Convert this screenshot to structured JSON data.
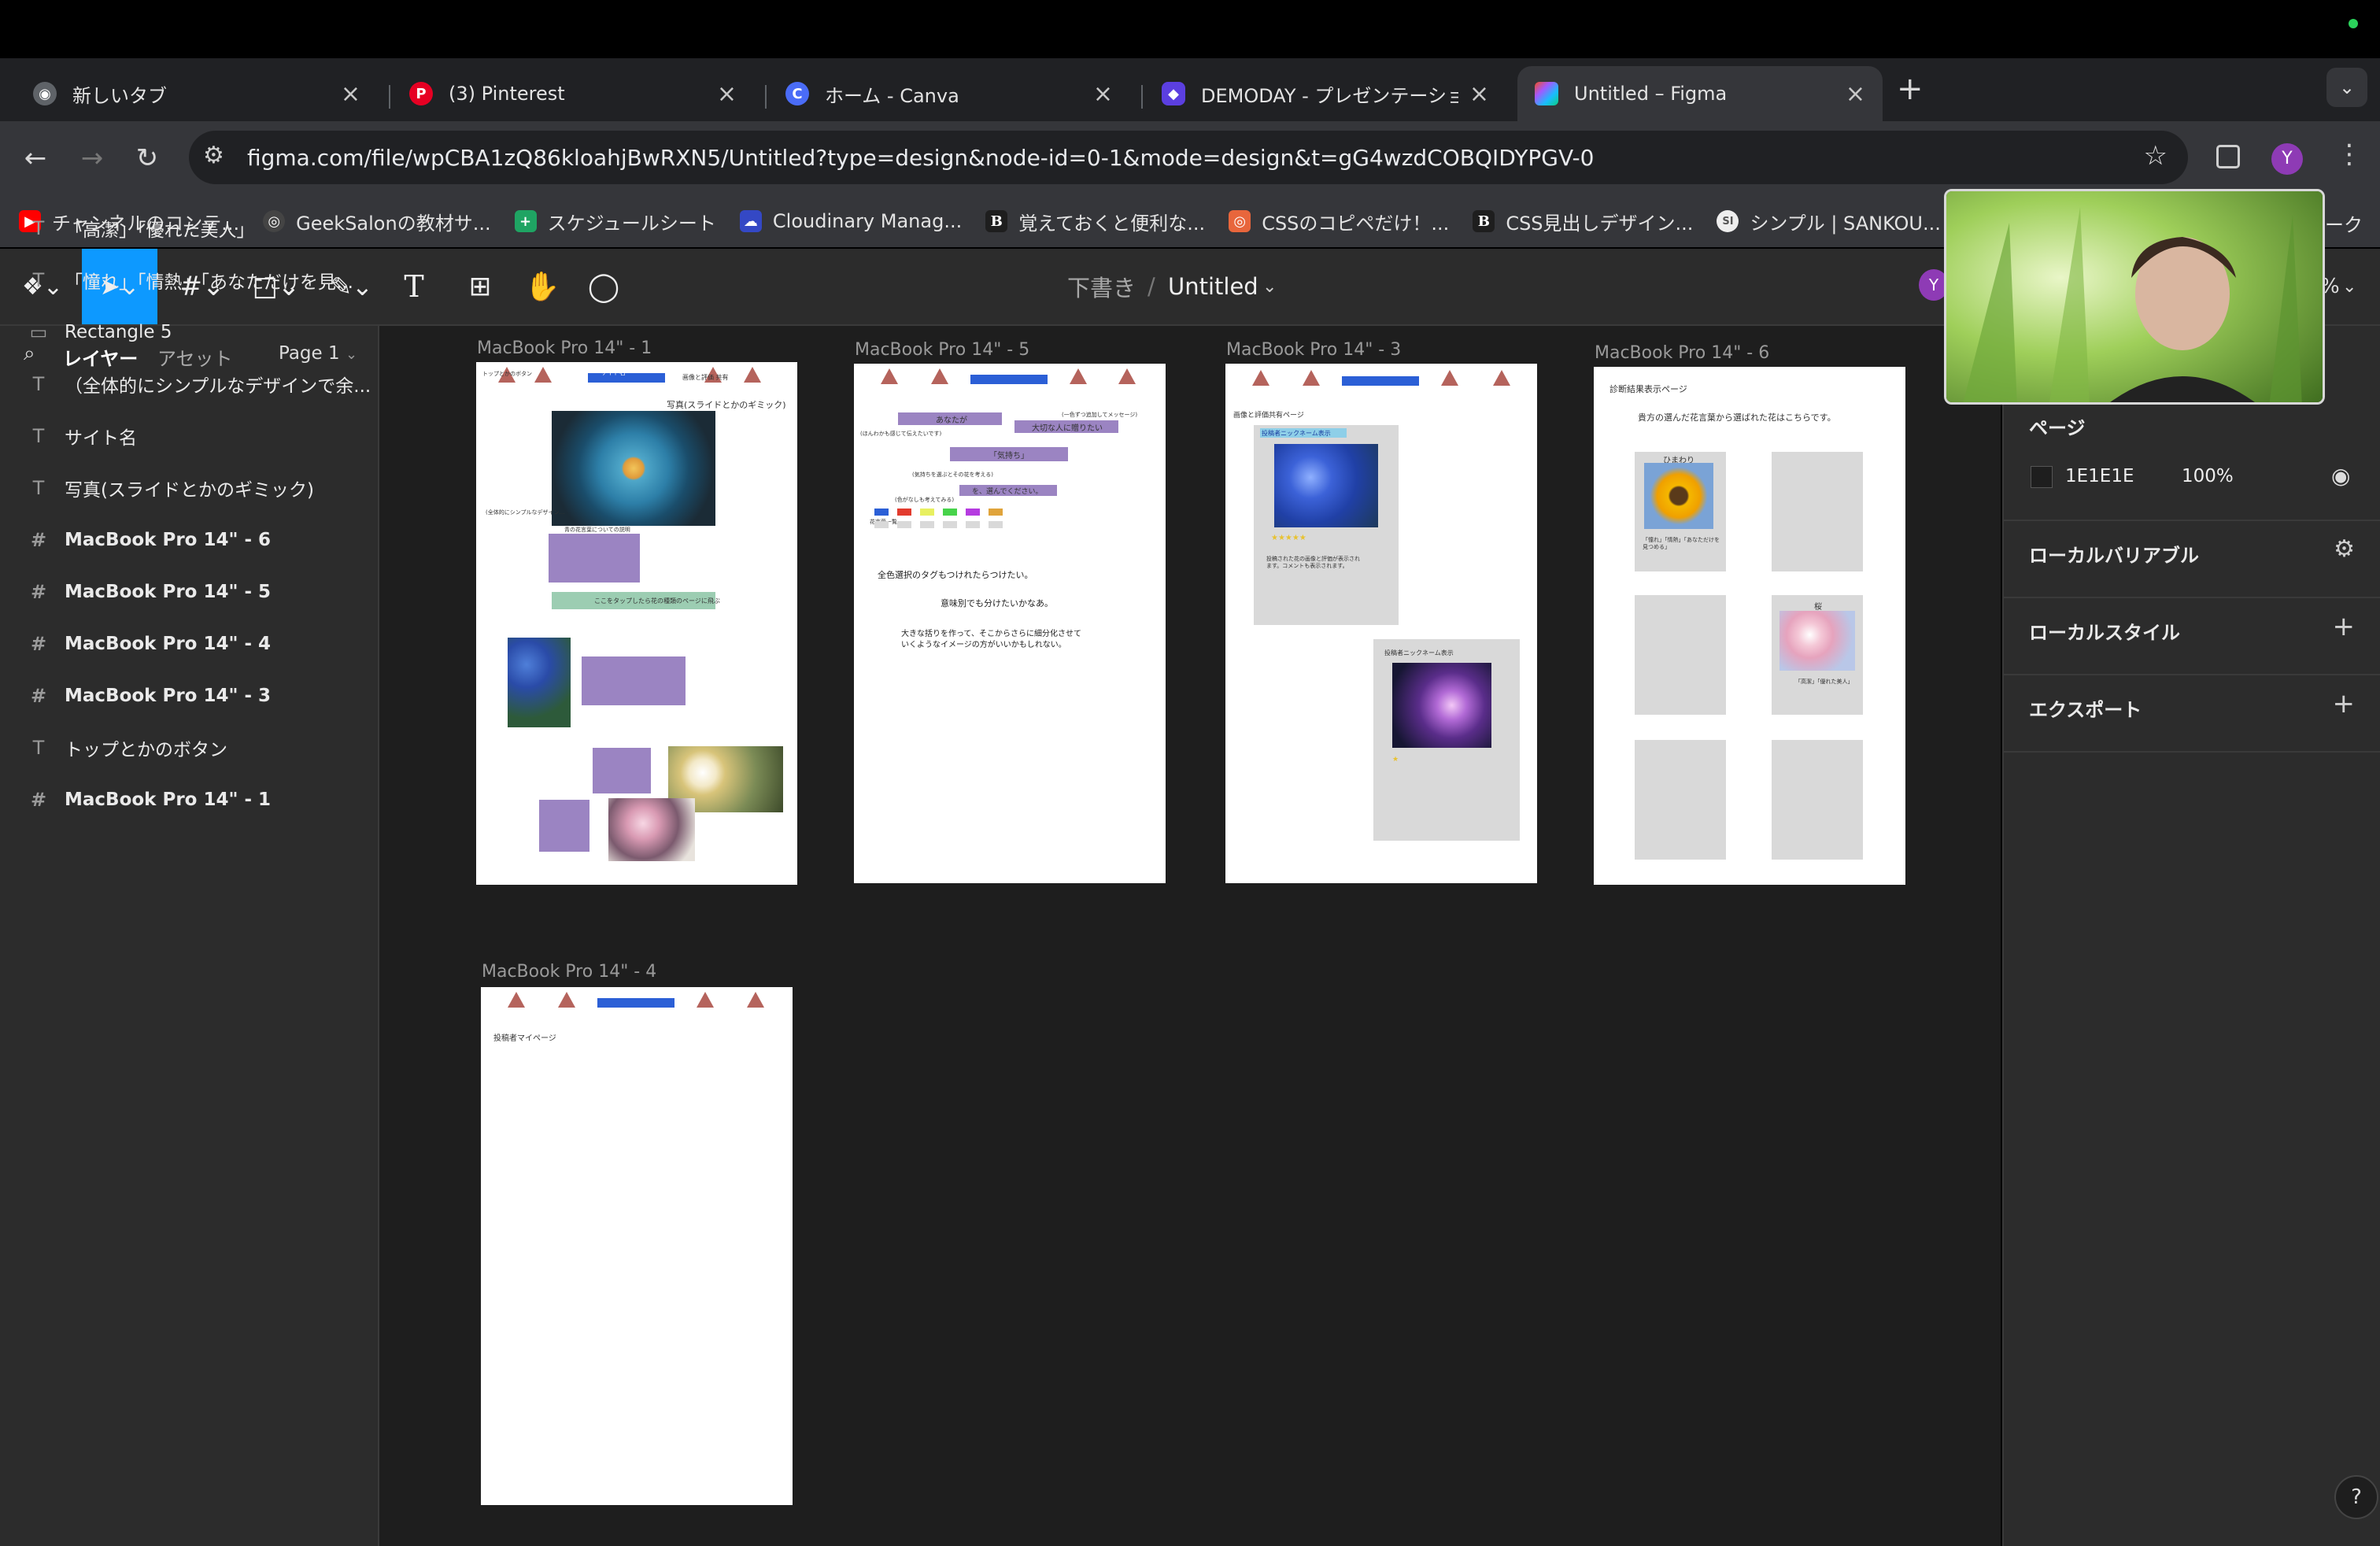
{
  "colors": {
    "accent": "#0d99ff",
    "purple_box": "#9b84c2",
    "blue_bar": "#2b5fd6",
    "triangle": "#b5635c",
    "gray_box": "#d9d9d9"
  },
  "browser": {
    "tabs": [
      {
        "title": "新しいタブ",
        "icon": "chrome-icon",
        "active": false
      },
      {
        "title": "(3) Pinterest",
        "icon": "pinterest-icon",
        "active": false
      },
      {
        "title": "ホーム - Canva",
        "icon": "canva-icon",
        "active": false
      },
      {
        "title": "DEMODAY - プレゼンテーショ",
        "icon": "demoday-icon",
        "active": false
      },
      {
        "title": "Untitled – Figma",
        "icon": "figma-icon",
        "active": true
      }
    ],
    "url": "figma.com/file/wpCBA1zQ86kloahjBwRXN5/Untitled?type=design&node-id=0-1&mode=design&t=gG4wzdCOBQIDYPGV-0",
    "profile_initial": "Y",
    "bookmarks": [
      {
        "label": "チャンネルのコンテ...",
        "icon": "youtube-icon"
      },
      {
        "label": "GeekSalonの教材サ...",
        "icon": "geeksalon-icon"
      },
      {
        "label": "スケジュールシート",
        "icon": "sheets-icon"
      },
      {
        "label": "Cloudinary Manag...",
        "icon": "cloudinary-icon"
      },
      {
        "label": "覚えておくと便利な...",
        "icon": "b-icon"
      },
      {
        "label": "CSSのコピペだけ！...",
        "icon": "css-icon"
      },
      {
        "label": "CSS見出しデザイン...",
        "icon": "b-icon"
      },
      {
        "label": "シンプル | SANKOU...",
        "icon": "sankou-icon"
      },
      {
        "label": "ーク",
        "icon": ""
      }
    ]
  },
  "figma": {
    "breadcrumb_folder": "下書き",
    "breadcrumb_sep": "/",
    "file_name": "Untitled",
    "user_initial": "Y",
    "zoom_suffix": "%",
    "left_panel": {
      "tab_layers": "レイヤー",
      "tab_assets": "アセット",
      "page_selector": "Page 1",
      "layers": [
        {
          "icon": "T",
          "label": "「高潔」「優れた美人」",
          "bold": false
        },
        {
          "icon": "T",
          "label": "「憧れ」「情熱」「あなただけを見...",
          "bold": false
        },
        {
          "icon": "▭",
          "label": "Rectangle 5",
          "bold": false
        },
        {
          "icon": "T",
          "label": "（全体的にシンプルなデザインで余...",
          "bold": false
        },
        {
          "icon": "T",
          "label": "サイト名",
          "bold": false
        },
        {
          "icon": "T",
          "label": "写真(スライドとかのギミック)",
          "bold": false
        },
        {
          "icon": "#",
          "label": "MacBook Pro 14\" - 6",
          "bold": true
        },
        {
          "icon": "#",
          "label": "MacBook Pro 14\" - 5",
          "bold": true
        },
        {
          "icon": "#",
          "label": "MacBook Pro 14\" - 4",
          "bold": true
        },
        {
          "icon": "#",
          "label": "MacBook Pro 14\" - 3",
          "bold": true
        },
        {
          "icon": "T",
          "label": "トップとかのボタン",
          "bold": false
        },
        {
          "icon": "#",
          "label": "MacBook Pro 14\" - 1",
          "bold": true
        }
      ]
    },
    "frames": {
      "f1": {
        "label": "MacBook Pro 14\" - 1",
        "t_top": "トップとかのボタン",
        "t_title": "サイト名",
        "t_right": "画像と評価 共有",
        "t_photo": "写真(スライドとかのギミック)",
        "t_side": "(全体的にシンプルなデザイン…",
        "t_caption": "青の花言葉についての説明",
        "t_green": "ここをタップしたら花の種類のページに飛ぶ"
      },
      "f5": {
        "label": "MacBook Pro 14\" - 5",
        "q1": "あなたが",
        "q1b": "(ほんわかも感じて伝えたいです)",
        "q2": "大切な人に贈りたい",
        "q2b": "(一色ずつ追加してメッセージ)",
        "q3": "「気持ち」",
        "q3b": "(気持ちを選ぶとその花を考える)",
        "q4": "を、選んでください。",
        "q4b": "(色がなしも考えてみる)",
        "q5b": "花言葉一覧",
        "note1": "全色選択のタグもつけれたらつけたい。",
        "note2": "意味別でも分けたいかなあ。",
        "note3a": "大きな括りを作って、そこからさらに細分化させて",
        "note3b": "いくようなイメージの方がいいかもしれない。",
        "swatches": [
          "#2b5fd6",
          "#e23b2e",
          "#e8f060",
          "#47d34a",
          "#b53be0",
          "#e0a43b"
        ]
      },
      "f3": {
        "label": "MacBook Pro 14\" - 3",
        "title": "画像と評価共有ページ",
        "card1_header": "投稿者ニックネーム表示",
        "stars": "★★★★★",
        "card1_desc": "投稿された花の画像と評価が表示されます。コメントも表示されます。",
        "card2_header": "投稿者ニックネーム表示",
        "card2_star": "★"
      },
      "f6": {
        "label": "MacBook Pro 14\" - 6",
        "title": "診断結果表示ページ",
        "subtitle": "貴方の選んだ花言葉から選ばれた花はこちらです。",
        "card1_name": "ひまわり",
        "card1_words": "「憧れ」「情熱」「あなただけを見つめる」",
        "card2_name": "桜",
        "card2_words": "「高潔」「優れた美人」"
      },
      "f4": {
        "label": "MacBook Pro 14\" - 4",
        "text": "投稿者マイページ"
      }
    },
    "right_panel": {
      "page_heading": "ページ",
      "page_color": "1E1E1E",
      "page_opacity": "100%",
      "local_variables": "ローカルバリアブル",
      "local_styles": "ローカルスタイル",
      "export": "エクスポート"
    },
    "help_label": "?"
  }
}
